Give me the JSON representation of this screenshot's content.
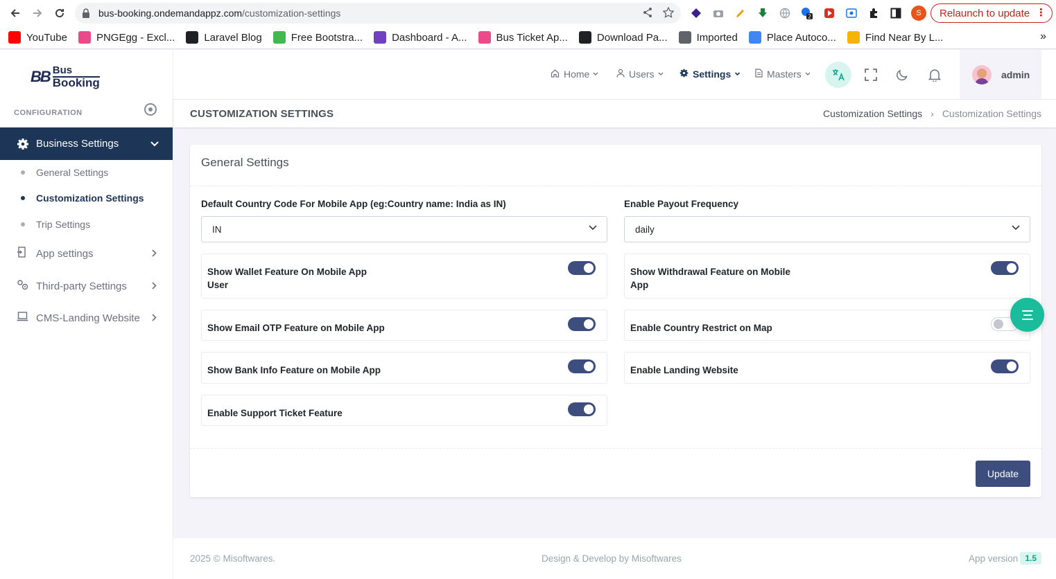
{
  "browser": {
    "url_host": "bus-booking.ondemandappz.com",
    "url_path": "/customization-settings",
    "relaunch_label": "Relaunch to update",
    "profile_initial": "S",
    "bookmarks": [
      {
        "label": "YouTube",
        "color": "#ff0000"
      },
      {
        "label": "PNGEgg - Excl...",
        "color": "#e94b8a"
      },
      {
        "label": "Laravel Blog",
        "color": "#202124"
      },
      {
        "label": "Free Bootstra...",
        "color": "#3fb950"
      },
      {
        "label": "Dashboard - A...",
        "color": "#6f42c1"
      },
      {
        "label": "Bus Ticket Ap...",
        "color": "#ea4c89"
      },
      {
        "label": "Download Pa...",
        "color": "#202124"
      },
      {
        "label": "Imported",
        "color": "#5f6368"
      },
      {
        "label": "Place Autoco...",
        "color": "#4285f4"
      },
      {
        "label": "Find Near By L...",
        "color": "#f4b400"
      }
    ]
  },
  "sidebar": {
    "logo_line1": "Bus",
    "logo_line2": "Booking",
    "logo_mark": "BB",
    "section_title": "CONFIGURATION",
    "active_menu": "Business Settings",
    "sub_items": [
      {
        "label": "General Settings",
        "active": false
      },
      {
        "label": "Customization Settings",
        "active": true
      },
      {
        "label": "Trip Settings",
        "active": false
      }
    ],
    "menu_items": [
      {
        "label": "App settings",
        "icon": "door-icon"
      },
      {
        "label": "Third-party Settings",
        "icon": "gears-icon"
      },
      {
        "label": "CMS-Landing Website",
        "icon": "laptop-icon"
      }
    ]
  },
  "topbar": {
    "nav": [
      {
        "label": "Home",
        "icon": "home-icon"
      },
      {
        "label": "Users",
        "icon": "user-icon"
      },
      {
        "label": "Settings",
        "icon": "gear-icon"
      },
      {
        "label": "Masters",
        "icon": "file-icon"
      }
    ],
    "user_name": "admin"
  },
  "page": {
    "title": "CUSTOMIZATION SETTINGS",
    "breadcrumb": [
      "Customization Settings",
      "Customization Settings"
    ]
  },
  "card": {
    "title": "General Settings",
    "country_label": "Default Country Code For Mobile App (eg:Country name: India as IN)",
    "country_value": "IN",
    "payout_label": "Enable Payout Frequency",
    "payout_value": "daily",
    "toggles_left": [
      {
        "label": "Show Wallet Feature On Mobile App User",
        "on": true
      },
      {
        "label": "Show Email OTP Feature on Mobile App",
        "on": true
      },
      {
        "label": "Show Bank Info Feature on Mobile App",
        "on": true
      },
      {
        "label": "Enable Support Ticket Feature",
        "on": true
      }
    ],
    "toggles_right": [
      {
        "label": "Show Withdrawal Feature on Mobile App",
        "on": true
      },
      {
        "label": "Enable Country Restrict on Map",
        "on": false
      },
      {
        "label": "Enable Landing Website",
        "on": true
      }
    ],
    "update_label": "Update"
  },
  "footer": {
    "copyright": "2025 © Misoftwares.",
    "credit": "Design & Develop by Misoftwares",
    "version_label": "App version",
    "version": "1.5"
  }
}
